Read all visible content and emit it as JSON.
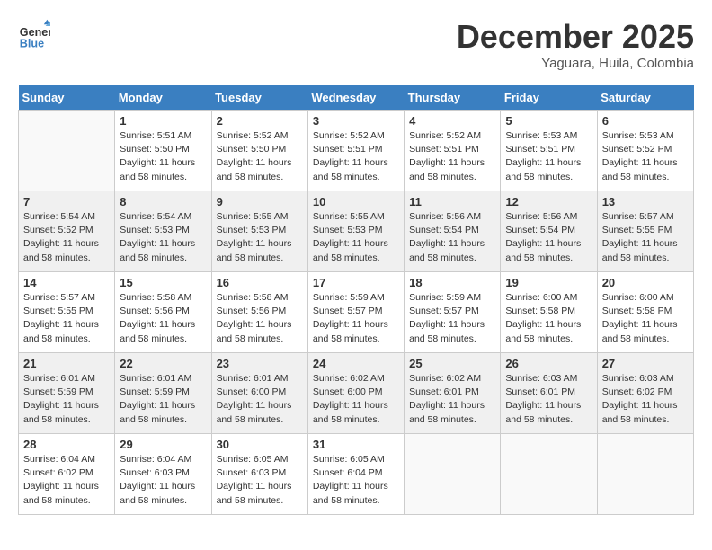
{
  "header": {
    "logo_line1": "General",
    "logo_line2": "Blue",
    "month": "December 2025",
    "location": "Yaguara, Huila, Colombia"
  },
  "weekdays": [
    "Sunday",
    "Monday",
    "Tuesday",
    "Wednesday",
    "Thursday",
    "Friday",
    "Saturday"
  ],
  "weeks": [
    [
      {
        "day": "",
        "info": ""
      },
      {
        "day": "1",
        "info": "Sunrise: 5:51 AM\nSunset: 5:50 PM\nDaylight: 11 hours\nand 58 minutes."
      },
      {
        "day": "2",
        "info": "Sunrise: 5:52 AM\nSunset: 5:50 PM\nDaylight: 11 hours\nand 58 minutes."
      },
      {
        "day": "3",
        "info": "Sunrise: 5:52 AM\nSunset: 5:51 PM\nDaylight: 11 hours\nand 58 minutes."
      },
      {
        "day": "4",
        "info": "Sunrise: 5:52 AM\nSunset: 5:51 PM\nDaylight: 11 hours\nand 58 minutes."
      },
      {
        "day": "5",
        "info": "Sunrise: 5:53 AM\nSunset: 5:51 PM\nDaylight: 11 hours\nand 58 minutes."
      },
      {
        "day": "6",
        "info": "Sunrise: 5:53 AM\nSunset: 5:52 PM\nDaylight: 11 hours\nand 58 minutes."
      }
    ],
    [
      {
        "day": "7",
        "info": "Sunrise: 5:54 AM\nSunset: 5:52 PM\nDaylight: 11 hours\nand 58 minutes."
      },
      {
        "day": "8",
        "info": "Sunrise: 5:54 AM\nSunset: 5:53 PM\nDaylight: 11 hours\nand 58 minutes."
      },
      {
        "day": "9",
        "info": "Sunrise: 5:55 AM\nSunset: 5:53 PM\nDaylight: 11 hours\nand 58 minutes."
      },
      {
        "day": "10",
        "info": "Sunrise: 5:55 AM\nSunset: 5:53 PM\nDaylight: 11 hours\nand 58 minutes."
      },
      {
        "day": "11",
        "info": "Sunrise: 5:56 AM\nSunset: 5:54 PM\nDaylight: 11 hours\nand 58 minutes."
      },
      {
        "day": "12",
        "info": "Sunrise: 5:56 AM\nSunset: 5:54 PM\nDaylight: 11 hours\nand 58 minutes."
      },
      {
        "day": "13",
        "info": "Sunrise: 5:57 AM\nSunset: 5:55 PM\nDaylight: 11 hours\nand 58 minutes."
      }
    ],
    [
      {
        "day": "14",
        "info": "Sunrise: 5:57 AM\nSunset: 5:55 PM\nDaylight: 11 hours\nand 58 minutes."
      },
      {
        "day": "15",
        "info": "Sunrise: 5:58 AM\nSunset: 5:56 PM\nDaylight: 11 hours\nand 58 minutes."
      },
      {
        "day": "16",
        "info": "Sunrise: 5:58 AM\nSunset: 5:56 PM\nDaylight: 11 hours\nand 58 minutes."
      },
      {
        "day": "17",
        "info": "Sunrise: 5:59 AM\nSunset: 5:57 PM\nDaylight: 11 hours\nand 58 minutes."
      },
      {
        "day": "18",
        "info": "Sunrise: 5:59 AM\nSunset: 5:57 PM\nDaylight: 11 hours\nand 58 minutes."
      },
      {
        "day": "19",
        "info": "Sunrise: 6:00 AM\nSunset: 5:58 PM\nDaylight: 11 hours\nand 58 minutes."
      },
      {
        "day": "20",
        "info": "Sunrise: 6:00 AM\nSunset: 5:58 PM\nDaylight: 11 hours\nand 58 minutes."
      }
    ],
    [
      {
        "day": "21",
        "info": "Sunrise: 6:01 AM\nSunset: 5:59 PM\nDaylight: 11 hours\nand 58 minutes."
      },
      {
        "day": "22",
        "info": "Sunrise: 6:01 AM\nSunset: 5:59 PM\nDaylight: 11 hours\nand 58 minutes."
      },
      {
        "day": "23",
        "info": "Sunrise: 6:01 AM\nSunset: 6:00 PM\nDaylight: 11 hours\nand 58 minutes."
      },
      {
        "day": "24",
        "info": "Sunrise: 6:02 AM\nSunset: 6:00 PM\nDaylight: 11 hours\nand 58 minutes."
      },
      {
        "day": "25",
        "info": "Sunrise: 6:02 AM\nSunset: 6:01 PM\nDaylight: 11 hours\nand 58 minutes."
      },
      {
        "day": "26",
        "info": "Sunrise: 6:03 AM\nSunset: 6:01 PM\nDaylight: 11 hours\nand 58 minutes."
      },
      {
        "day": "27",
        "info": "Sunrise: 6:03 AM\nSunset: 6:02 PM\nDaylight: 11 hours\nand 58 minutes."
      }
    ],
    [
      {
        "day": "28",
        "info": "Sunrise: 6:04 AM\nSunset: 6:02 PM\nDaylight: 11 hours\nand 58 minutes."
      },
      {
        "day": "29",
        "info": "Sunrise: 6:04 AM\nSunset: 6:03 PM\nDaylight: 11 hours\nand 58 minutes."
      },
      {
        "day": "30",
        "info": "Sunrise: 6:05 AM\nSunset: 6:03 PM\nDaylight: 11 hours\nand 58 minutes."
      },
      {
        "day": "31",
        "info": "Sunrise: 6:05 AM\nSunset: 6:04 PM\nDaylight: 11 hours\nand 58 minutes."
      },
      {
        "day": "",
        "info": ""
      },
      {
        "day": "",
        "info": ""
      },
      {
        "day": "",
        "info": ""
      }
    ]
  ]
}
